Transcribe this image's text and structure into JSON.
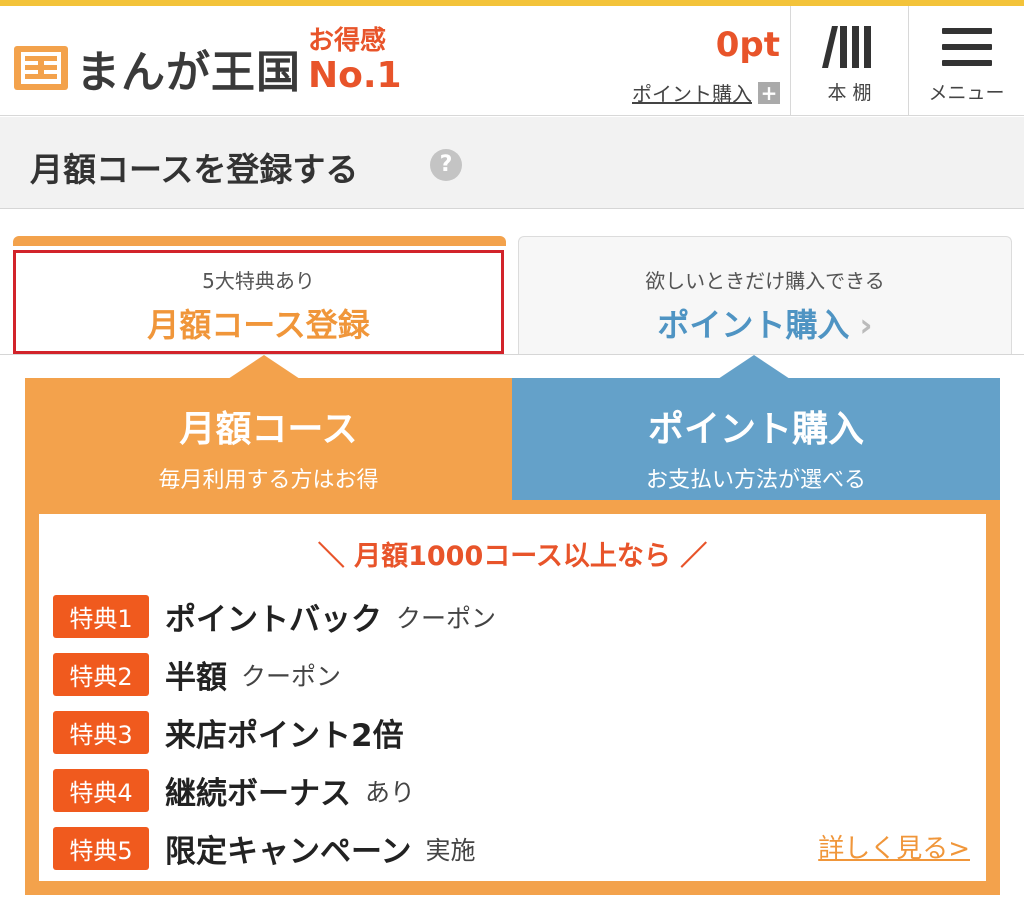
{
  "header": {
    "logo_text": "まんが王国",
    "badge_line1": "お得感",
    "badge_line2": "No.1",
    "points_value": "0pt",
    "buy_points_link": "ポイント購入",
    "bookshelf_label": "本 棚",
    "menu_label": "メニュー"
  },
  "title_bar": {
    "title": "月額コースを登録する",
    "help": "?"
  },
  "tabs": {
    "left": {
      "sub": "5大特典あり",
      "main": "月額コース登録"
    },
    "right": {
      "sub": "欲しいときだけ購入できる",
      "main": "ポイント購入",
      "chevron": "›"
    }
  },
  "panels": {
    "left": {
      "title": "月額コース",
      "subtitle": "毎月利用する方はお得"
    },
    "right": {
      "title": "ポイント購入",
      "subtitle": "お支払い方法が選べる"
    }
  },
  "benefits": {
    "heading": "＼ 月額1000コース以上なら ／",
    "items": [
      {
        "tag": "特典1",
        "name": "ポイントバック",
        "note": "クーポン"
      },
      {
        "tag": "特典2",
        "name": "半額",
        "note": "クーポン"
      },
      {
        "tag": "特典3",
        "name": "来店ポイント2倍",
        "note": ""
      },
      {
        "tag": "特典4",
        "name": "継続ボーナス",
        "note": "あり"
      },
      {
        "tag": "特典5",
        "name": "限定キャンペーン",
        "note": "実施"
      }
    ],
    "more_link": "詳しく見る>"
  },
  "colors": {
    "orange": "#f3a24c",
    "blue": "#64a1c9",
    "red_accent": "#e8542a",
    "tag_orange": "#f05a1e",
    "selected_border": "#d2232a"
  }
}
